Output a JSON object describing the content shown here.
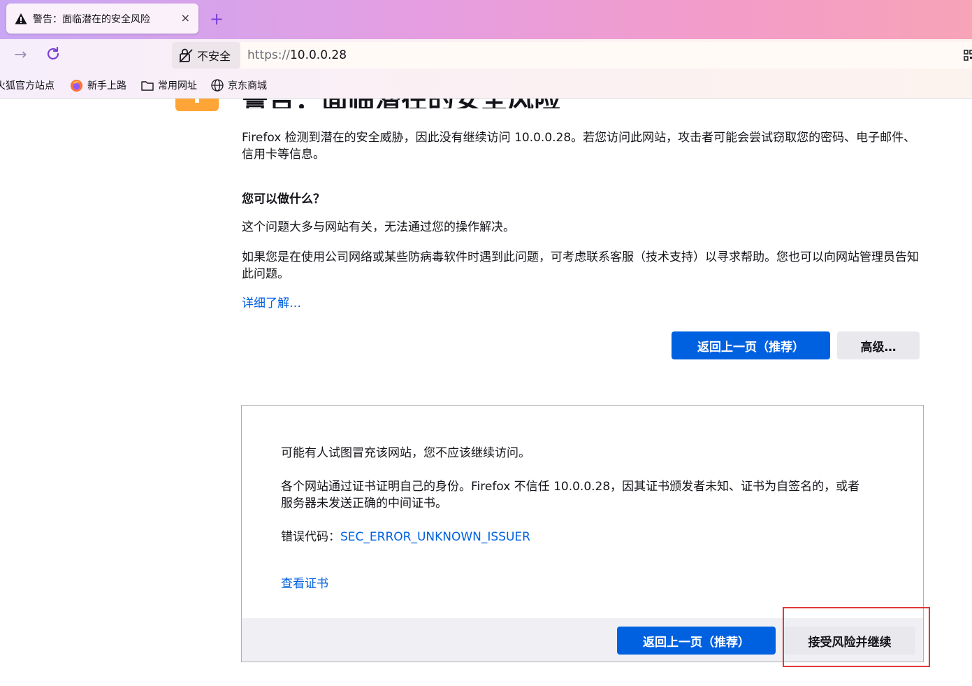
{
  "browser": {
    "tab_title": "警告：面临潜在的安全风险",
    "tab_close": "×",
    "new_tab": "+",
    "url_security_label": "不安全",
    "url_scheme": "https://",
    "url_host": "10.0.0.28",
    "bookmarks": [
      {
        "label": "火狐官方站点"
      },
      {
        "label": "新手上路"
      },
      {
        "label": "常用网址"
      },
      {
        "label": "京东商城"
      }
    ]
  },
  "page": {
    "heading": "警告：面临潜在的安全风险",
    "intro": "Firefox 检测到潜在的安全威胁，因此没有继续访问 10.0.0.28。若您访问此网站，攻击者可能会尝试窃取您的密码、电子邮件、信用卡等信息。",
    "what_heading": "您可以做什么？",
    "what_p1": "这个问题大多与网站有关，无法通过您的操作解决。",
    "what_p2": "如果您是在使用公司网络或某些防病毒软件时遇到此问题，可考虑联系客服（技术支持）以寻求帮助。您也可以向网站管理员告知此问题。",
    "learn_more": "详细了解…",
    "go_back_button": "返回上一页（推荐）",
    "advanced_button": "高级…",
    "advanced": {
      "p1": "可能有人试图冒充该网站，您不应该继续访问。",
      "p2": "各个网站通过证书证明自己的身份。Firefox 不信任 10.0.0.28，因其证书颁发者未知、证书为自签名的，或者服务器未发送正确的中间证书。",
      "error_label": "错误代码：",
      "error_code": "SEC_ERROR_UNKNOWN_ISSUER",
      "view_cert": "查看证书",
      "go_back_button": "返回上一页（推荐）",
      "accept_button": "接受风险并继续"
    }
  },
  "colors": {
    "accent_blue": "#0061e0",
    "warning_orange": "#ffa436",
    "highlight_red": "#e0393b"
  }
}
